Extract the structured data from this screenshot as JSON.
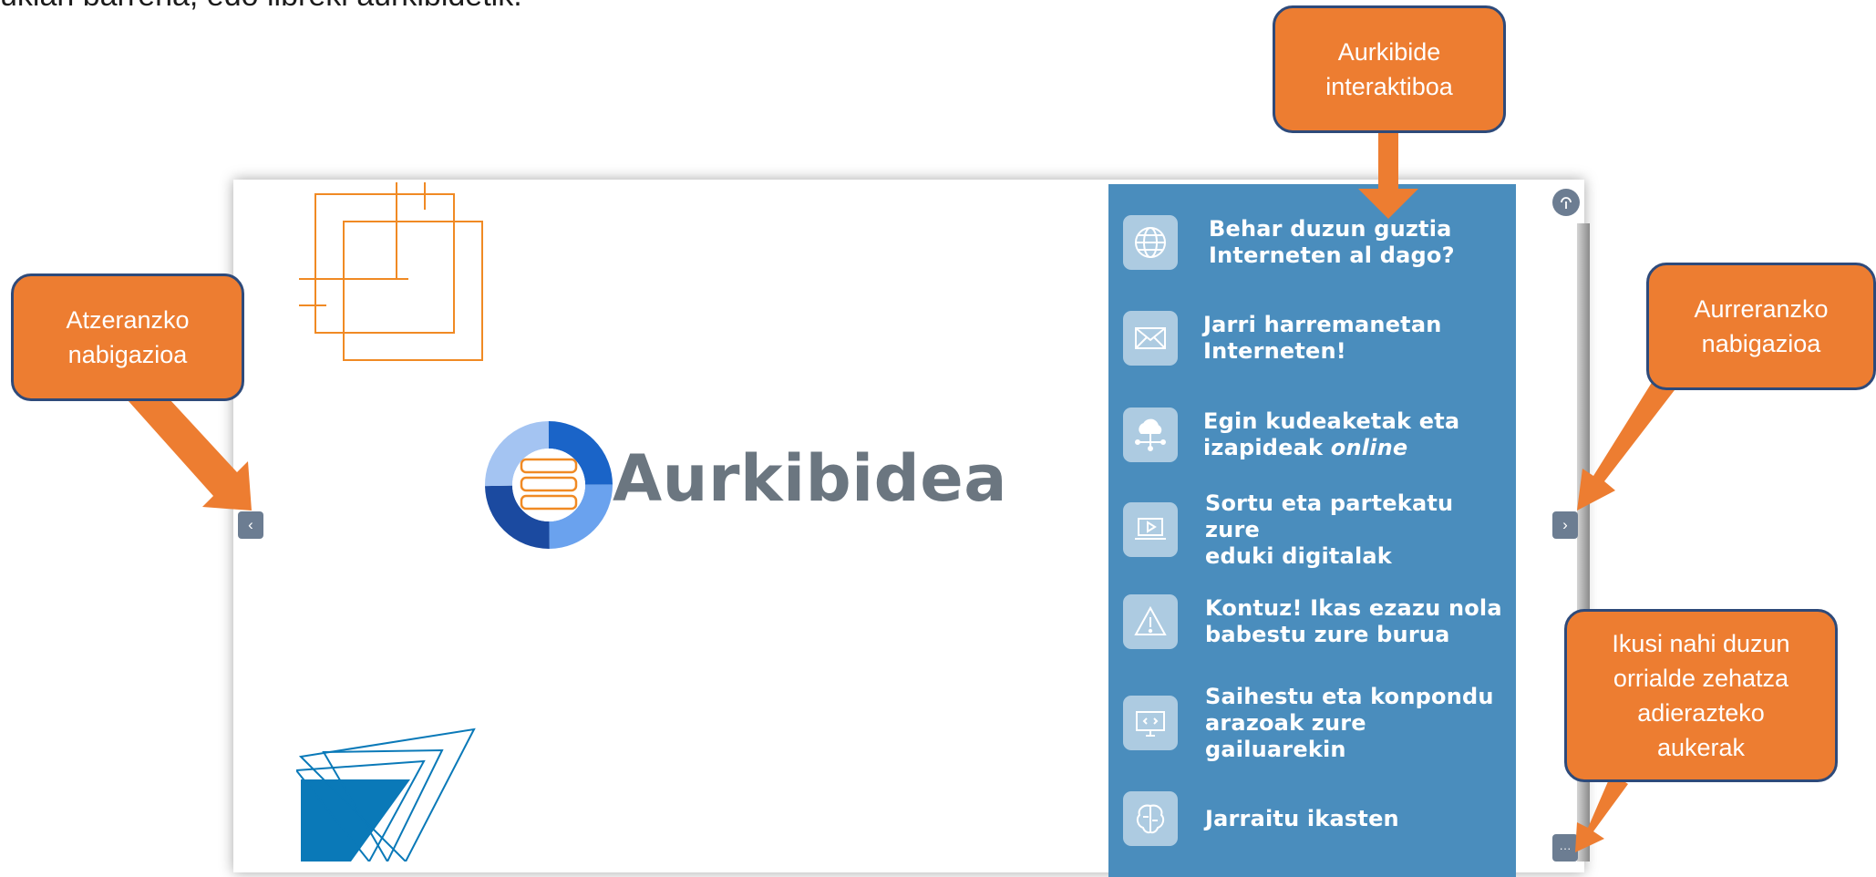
{
  "top_text": "ukian barrena, edo libreki aurkibidetik.",
  "slide": {
    "logo_text": "Aurkibidea"
  },
  "menu": {
    "items": [
      {
        "line1": "Behar duzun guztia",
        "line2": "Interneten al dago?",
        "icon": "globe-icon"
      },
      {
        "line1": "Jarri harremanetan",
        "line2": "Interneten!",
        "icon": "envelope-icon"
      },
      {
        "line1": "Egin kudeaketak eta",
        "line2_prefix": "izapideak ",
        "line2_italic": "online",
        "icon": "cloud-network-icon"
      },
      {
        "line1": "Sortu eta partekatu zure",
        "line2": "eduki digitalak",
        "icon": "laptop-video-icon"
      },
      {
        "line1": "Kontuz! Ikas ezazu nola",
        "line2": "babestu zure burua",
        "icon": "warning-icon"
      },
      {
        "line1": "Saihestu eta konpondu",
        "line2": "arazoak zure gailuarekin",
        "icon": "monitor-tools-icon"
      },
      {
        "line1": "Jarraitu ikasten",
        "icon": "brain-icon"
      }
    ]
  },
  "nav": {
    "prev": "‹",
    "next": "›",
    "more": "···"
  },
  "callouts": {
    "index": {
      "line1": "Aurkibide",
      "line2": "interaktiboa"
    },
    "back": {
      "line1": "Atzeranzko",
      "line2": "nabigazioa"
    },
    "forward": {
      "line1": "Aurreranzko",
      "line2": "nabigazioa"
    },
    "options": {
      "line1": "Ikusi nahi duzun",
      "line2": "orrialde zehatza",
      "line3": "adierazteko",
      "line4": "aukerak"
    }
  },
  "colors": {
    "callout_fill": "#ed7d31",
    "callout_border": "#2e4a7a",
    "panel": "#4a8dbd",
    "logo_text": "#6b7680",
    "nav_button": "#6c7d92"
  }
}
